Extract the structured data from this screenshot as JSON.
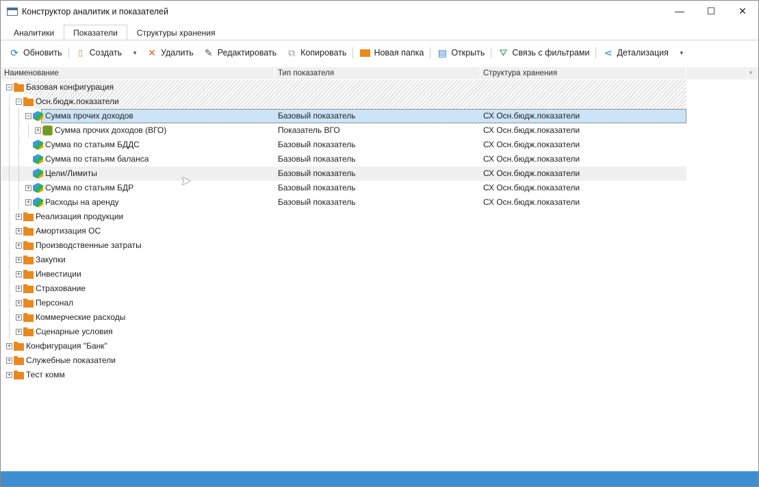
{
  "window": {
    "title": "Конструктор аналитик и показателей",
    "minimize": "—",
    "maximize": "☐",
    "close": "✕"
  },
  "tabs": [
    {
      "label": "Аналитики"
    },
    {
      "label": "Показатели",
      "active": true
    },
    {
      "label": "Структуры хранения"
    }
  ],
  "toolbar": {
    "refresh": "Обновить",
    "create": "Создать",
    "delete": "Удалить",
    "edit": "Редактировать",
    "copy": "Копировать",
    "new_folder": "Новая папка",
    "open": "Открыть",
    "filters": "Связь с фильтрами",
    "detail": "Детализация"
  },
  "columns": [
    "Наименование",
    "Тип показателя",
    "Структура хранения"
  ],
  "rows": [
    {
      "level": 0,
      "expander": "minus",
      "icon": "folder",
      "name": "Базовая конфигурация",
      "type": "",
      "struct": "",
      "hatched": true
    },
    {
      "level": 1,
      "expander": "minus",
      "icon": "folder",
      "name": "Осн.бюдж.показатели",
      "type": "",
      "struct": "",
      "hatched": true
    },
    {
      "level": 2,
      "expander": "minus",
      "icon": "cube",
      "name": "Сумма прочих доходов",
      "type": "Базовый показатель",
      "struct": "СХ Осн.бюдж.показатели",
      "selected": true
    },
    {
      "level": 3,
      "expander": "plus",
      "icon": "vgo",
      "name": "Сумма прочих доходов (ВГО)",
      "type": "Показатель ВГО",
      "struct": "СХ Осн.бюдж.показатели"
    },
    {
      "level": 2,
      "expander": "none",
      "icon": "cube",
      "name": "Сумма по статьям БДДС",
      "type": "Базовый показатель",
      "struct": "СХ Осн.бюдж.показатели"
    },
    {
      "level": 2,
      "expander": "none",
      "icon": "cube",
      "name": "Сумма по статьям баланса",
      "type": "Базовый показатель",
      "struct": "СХ Осн.бюдж.показатели"
    },
    {
      "level": 2,
      "expander": "none",
      "icon": "cube",
      "name": "Цели/Лимиты",
      "type": "Базовый показатель",
      "struct": "СХ Осн.бюдж.показатели",
      "hover": true
    },
    {
      "level": 2,
      "expander": "plus",
      "icon": "cube",
      "name": "Сумма по статьям БДР",
      "type": "Базовый показатель",
      "struct": "СХ Осн.бюдж.показатели"
    },
    {
      "level": 2,
      "expander": "plus",
      "icon": "cube",
      "name": "Расходы на аренду",
      "type": "Базовый показатель",
      "struct": "СХ Осн.бюдж.показатели"
    },
    {
      "level": 1,
      "expander": "plus",
      "icon": "folder",
      "name": "Реализация продукции",
      "type": "",
      "struct": ""
    },
    {
      "level": 1,
      "expander": "plus",
      "icon": "folder",
      "name": "Амортизация ОС",
      "type": "",
      "struct": ""
    },
    {
      "level": 1,
      "expander": "plus",
      "icon": "folder",
      "name": "Производственные затраты",
      "type": "",
      "struct": ""
    },
    {
      "level": 1,
      "expander": "plus",
      "icon": "folder",
      "name": "Закупки",
      "type": "",
      "struct": ""
    },
    {
      "level": 1,
      "expander": "plus",
      "icon": "folder",
      "name": "Инвестиции",
      "type": "",
      "struct": ""
    },
    {
      "level": 1,
      "expander": "plus",
      "icon": "folder",
      "name": "Страхование",
      "type": "",
      "struct": ""
    },
    {
      "level": 1,
      "expander": "plus",
      "icon": "folder",
      "name": "Персонал",
      "type": "",
      "struct": ""
    },
    {
      "level": 1,
      "expander": "plus",
      "icon": "folder",
      "name": "Коммерческие расходы",
      "type": "",
      "struct": ""
    },
    {
      "level": 1,
      "expander": "plus",
      "icon": "folder",
      "name": "Сценарные условия",
      "type": "",
      "struct": ""
    },
    {
      "level": 0,
      "expander": "plus",
      "icon": "folder",
      "name": "Конфигурация \"Банк\"",
      "type": "",
      "struct": ""
    },
    {
      "level": 0,
      "expander": "plus",
      "icon": "folder",
      "name": "Служебные показатели",
      "type": "",
      "struct": ""
    },
    {
      "level": 0,
      "expander": "plus",
      "icon": "folder",
      "name": "Тест комм",
      "type": "",
      "struct": ""
    }
  ]
}
